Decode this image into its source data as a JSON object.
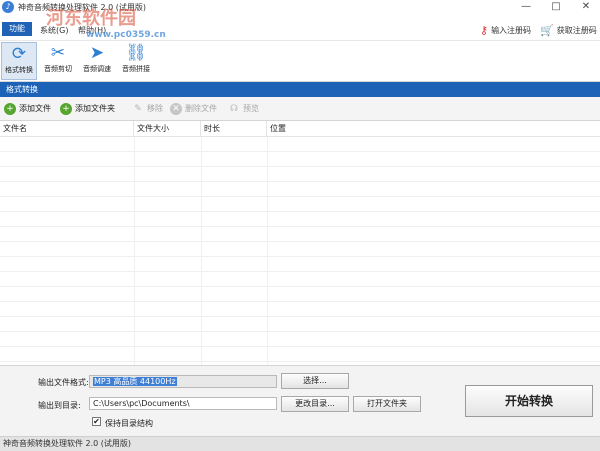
{
  "window": {
    "title": "神奇音频转换处理软件 2.0 (试用版)",
    "watermark": "河东软件园",
    "watermark_url": "www.pc0359.cn",
    "controls": {
      "minimize": "—",
      "maximize": "□",
      "close": "✕"
    }
  },
  "menu": {
    "items": [
      {
        "label": "功能"
      },
      {
        "label": "系统(G)"
      },
      {
        "label": "帮助(H)"
      }
    ],
    "register_code_label": "输入注册码",
    "get_code_label": "获取注册码",
    "key_icon": "key-icon",
    "cart_icon": "cart-icon"
  },
  "toolbar": {
    "tools": [
      {
        "label": "格式转换",
        "icon": "convert-icon",
        "glyph": "⟳"
      },
      {
        "label": "音频剪切",
        "icon": "crop-icon",
        "glyph": "✂"
      },
      {
        "label": "音频调速",
        "icon": "speed-icon",
        "glyph": "➤"
      },
      {
        "label": "音频拼接",
        "icon": "join-icon",
        "glyph": "⛓"
      }
    ]
  },
  "section": {
    "title": "格式转换"
  },
  "actions": {
    "add_file": "添加文件",
    "add_folder": "添加文件夹",
    "remove": "移除",
    "delete_file": "删除文件",
    "preview": "预览"
  },
  "table": {
    "columns": [
      {
        "label": "文件名"
      },
      {
        "label": "文件大小"
      },
      {
        "label": "时长"
      },
      {
        "label": "位置"
      }
    ],
    "rows": []
  },
  "output": {
    "format_label": "输出文件格式:",
    "format_value": "MP3 高品质 44100Hz",
    "select_button": "选择...",
    "dir_label": "输出到目录:",
    "dir_value": "C:\\Users\\pc\\Documents\\",
    "change_dir_button": "更改目录...",
    "open_folder_button": "打开文件夹",
    "keep_structure_label": "保持目录结构",
    "keep_structure_checked": true,
    "start_button": "开始转换"
  },
  "status": {
    "text": "神奇音频转换处理软件 2.0 (试用版)"
  },
  "colors": {
    "accent": "#1c63b8",
    "section_header": "#1c63b8",
    "selection": "#3f7fd6"
  }
}
